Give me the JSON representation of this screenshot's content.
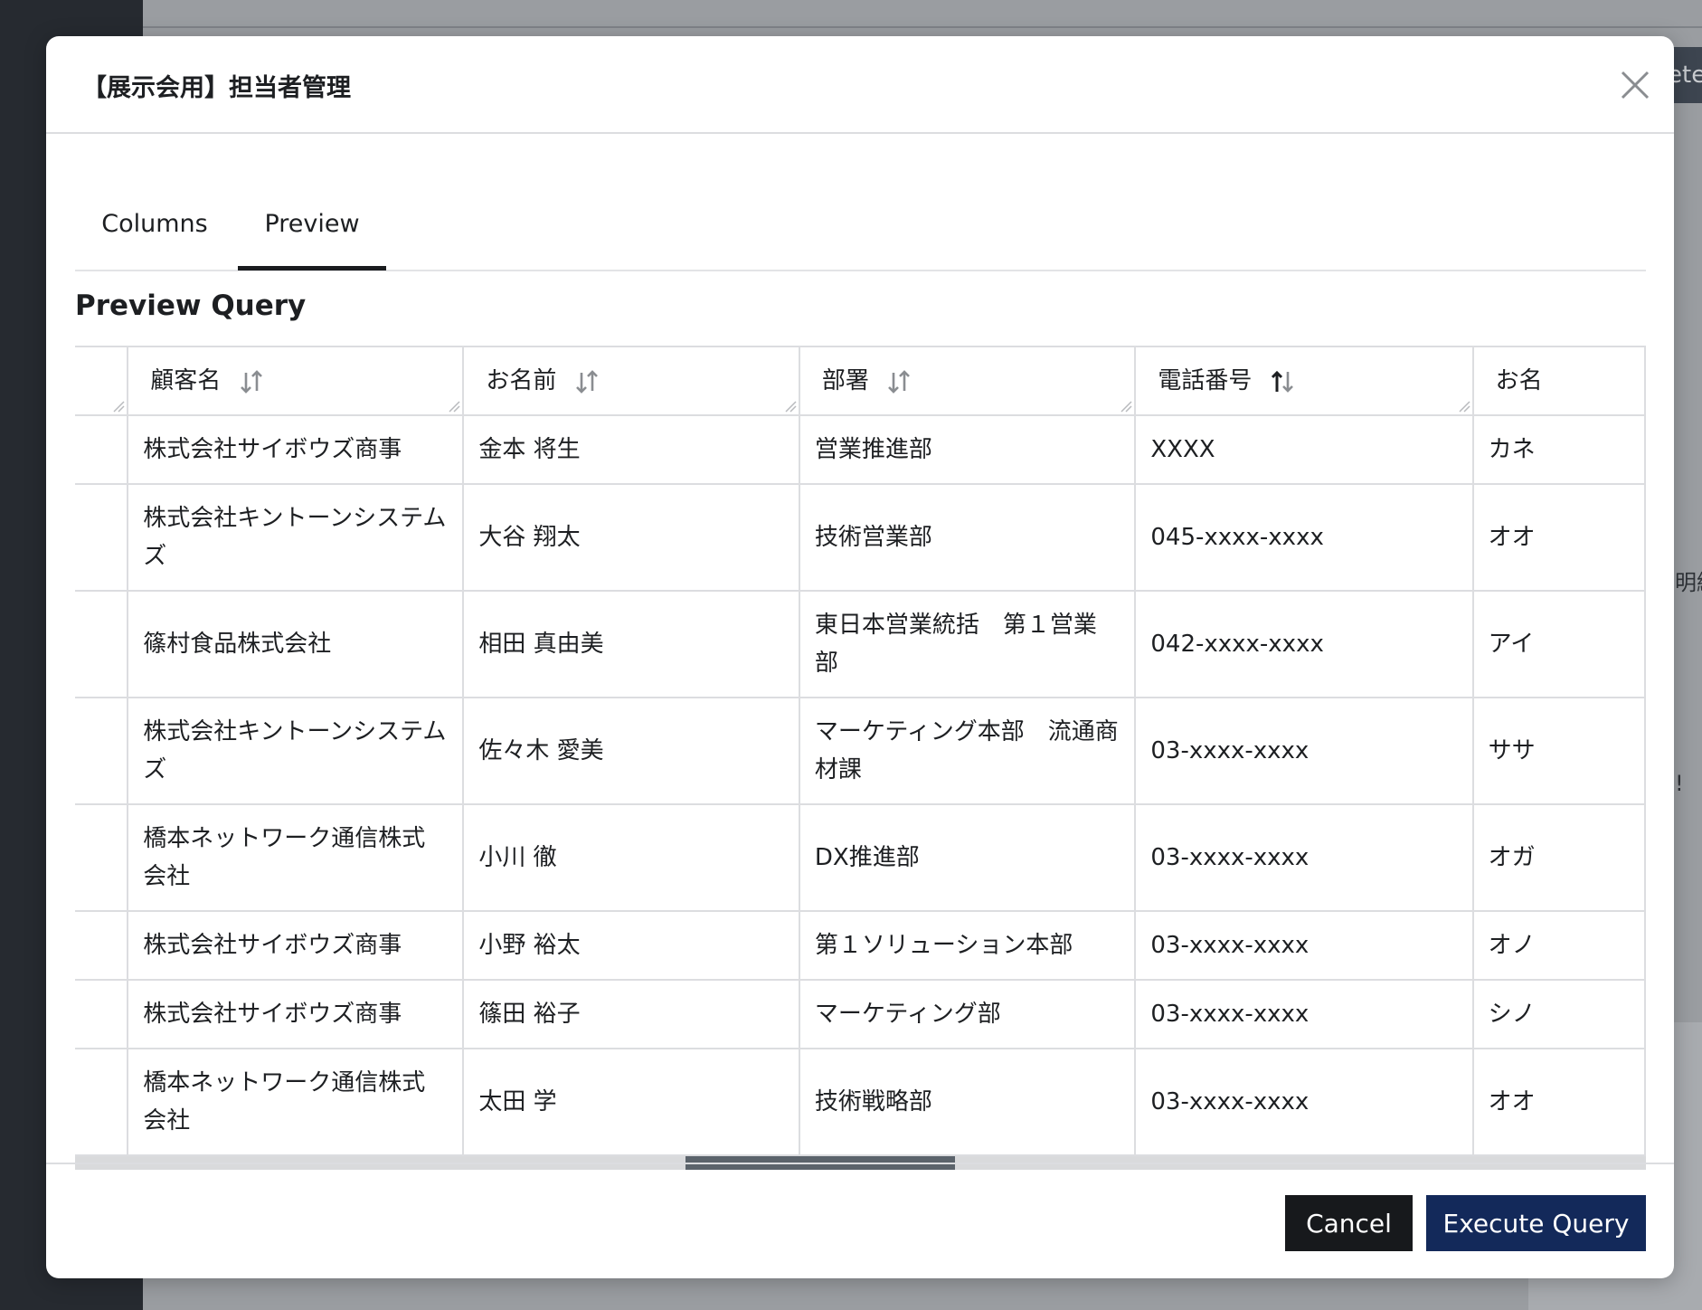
{
  "background": {
    "button_peek": "ete",
    "peek_text_1": "明細",
    "peek_text_2": "!"
  },
  "modal": {
    "title": "【展示会用】担当者管理",
    "tabs": [
      {
        "label": "Columns",
        "active": false
      },
      {
        "label": "Preview",
        "active": true
      }
    ],
    "section_title": "Preview Query"
  },
  "table": {
    "columns": [
      {
        "label": "",
        "sort": "none"
      },
      {
        "label": "顧客名",
        "sort": "unsorted"
      },
      {
        "label": "お名前",
        "sort": "unsorted"
      },
      {
        "label": "部署",
        "sort": "unsorted"
      },
      {
        "label": "電話番号",
        "sort": "ascending"
      },
      {
        "label": "お名",
        "sort": "unsorted"
      }
    ],
    "rows": [
      [
        "",
        "株式会社サイボウズ商事",
        "金本 将生",
        "営業推進部",
        "XXXX",
        "カネ"
      ],
      [
        "",
        "株式会社キントーンシステムズ",
        "大谷 翔太",
        "技術営業部",
        "045-xxxx-xxxx",
        "オオ"
      ],
      [
        "",
        "篠村食品株式会社",
        "相田 真由美",
        "東日本営業統括　第１営業部",
        "042-xxxx-xxxx",
        "アイ"
      ],
      [
        "",
        "株式会社キントーンシステムズ",
        "佐々木 愛美",
        "マーケティング本部　流通商材課",
        "03-xxxx-xxxx",
        "ササ"
      ],
      [
        "",
        "橋本ネットワーク通信株式会社",
        "小川 徹",
        "DX推進部",
        "03-xxxx-xxxx",
        "オガ"
      ],
      [
        "",
        "株式会社サイボウズ商事",
        "小野 裕太",
        "第１ソリューション本部",
        "03-xxxx-xxxx",
        "オノ"
      ],
      [
        "",
        "株式会社サイボウズ商事",
        "篠田 裕子",
        "マーケティング部",
        "03-xxxx-xxxx",
        "シノ"
      ],
      [
        "",
        "橋本ネットワーク通信株式会社",
        "太田 学",
        "技術戦略部",
        "03-xxxx-xxxx",
        "オオ"
      ]
    ]
  },
  "footer": {
    "cancel_label": "Cancel",
    "execute_label": "Execute Query"
  },
  "colors": {
    "execute_button": "#13295a",
    "cancel_button": "#17191c",
    "sidebar": "#262a30",
    "overlay": "#9a9da1"
  }
}
